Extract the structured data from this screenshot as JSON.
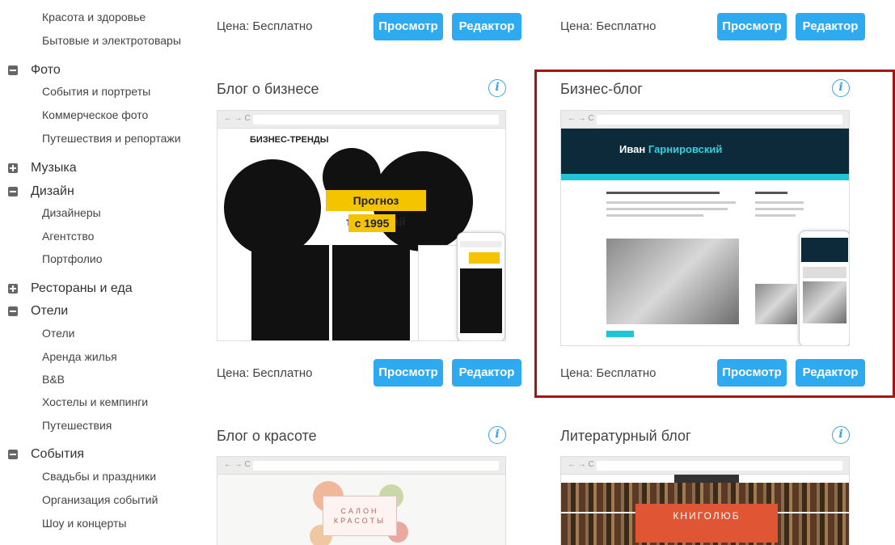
{
  "sidebar": {
    "items": [
      {
        "type": "sub",
        "label": "Красота и здоровье"
      },
      {
        "type": "sub",
        "label": "Бытовые и электротовары"
      },
      {
        "type": "cat",
        "label": "Фото",
        "state": "minus"
      },
      {
        "type": "sub",
        "label": "События и портреты"
      },
      {
        "type": "sub",
        "label": "Коммерческое фото"
      },
      {
        "type": "sub",
        "label": "Путешествия и репортажи"
      },
      {
        "type": "cat",
        "label": "Музыка",
        "state": "plus"
      },
      {
        "type": "cat",
        "label": "Дизайн",
        "state": "minus"
      },
      {
        "type": "sub",
        "label": "Дизайнеры"
      },
      {
        "type": "sub",
        "label": "Агентство"
      },
      {
        "type": "sub",
        "label": "Портфолио"
      },
      {
        "type": "cat",
        "label": "Рестораны и еда",
        "state": "plus"
      },
      {
        "type": "cat",
        "label": "Отели",
        "state": "minus"
      },
      {
        "type": "sub",
        "label": "Отели"
      },
      {
        "type": "sub",
        "label": "Аренда жилья"
      },
      {
        "type": "sub",
        "label": "B&B"
      },
      {
        "type": "sub",
        "label": "Хостелы и кемпинги"
      },
      {
        "type": "sub",
        "label": "Путешествия"
      },
      {
        "type": "cat",
        "label": "События",
        "state": "minus"
      },
      {
        "type": "sub",
        "label": "Свадьбы и праздники"
      },
      {
        "type": "sub",
        "label": "Организация событий"
      },
      {
        "type": "sub",
        "label": "Шоу и концерты"
      }
    ]
  },
  "common": {
    "price": "Цена: Бесплатно",
    "view": "Просмотр",
    "edit": "Редактор",
    "info_icon": "i"
  },
  "cards": {
    "business_blog": {
      "title": "Блог о бизнесе",
      "logo": "БИЗНЕС-ТРЕНДЫ",
      "tag1": "Прогноз тенденций",
      "tag2": "с 1995"
    },
    "biz_blog": {
      "title": "Бизнес-блог",
      "name_first": "Иван",
      "name_last": "Гарнировский"
    },
    "beauty_blog": {
      "title": "Блог о красоте",
      "salon_line1": "САЛОН",
      "salon_line2": "КРАСОТЫ"
    },
    "lit_blog": {
      "title": "Литературный блог",
      "tag": "КНИГОЛЮБ"
    }
  },
  "colors": {
    "accent": "#2eaaf0",
    "highlight": "#a31616"
  }
}
